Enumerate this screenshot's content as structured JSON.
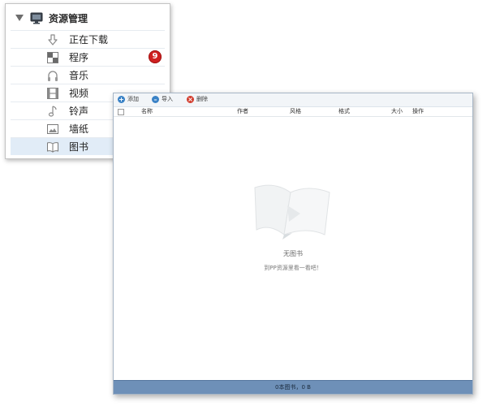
{
  "sidebar": {
    "title": "资源管理",
    "items": [
      {
        "label": "正在下载",
        "icon": "download-arrow-icon"
      },
      {
        "label": "程序",
        "icon": "apps-grid-icon",
        "badge": "9"
      },
      {
        "label": "音乐",
        "icon": "headphones-icon"
      },
      {
        "label": "视频",
        "icon": "film-icon"
      },
      {
        "label": "铃声",
        "icon": "music-note-icon"
      },
      {
        "label": "墙纸",
        "icon": "picture-icon"
      },
      {
        "label": "图书",
        "icon": "open-book-icon"
      }
    ],
    "active_item": "图书"
  },
  "window": {
    "toolbar": {
      "add_label": "添加",
      "import_label": "导入",
      "delete_label": "删除"
    },
    "columns": [
      "名称",
      "作者",
      "风格",
      "格式",
      "大小",
      "操作"
    ],
    "empty_title": "无图书",
    "empty_subtitle": "到PP资源里看一看吧！",
    "status": "0本图书，0 B"
  },
  "colors": {
    "badge": "#cf2020",
    "active_row": "#e1ecf7",
    "status_bar": "#6e90b8",
    "add_icon": "#3a82c6",
    "import_icon": "#3a82c6",
    "delete_icon": "#d23b2c"
  }
}
